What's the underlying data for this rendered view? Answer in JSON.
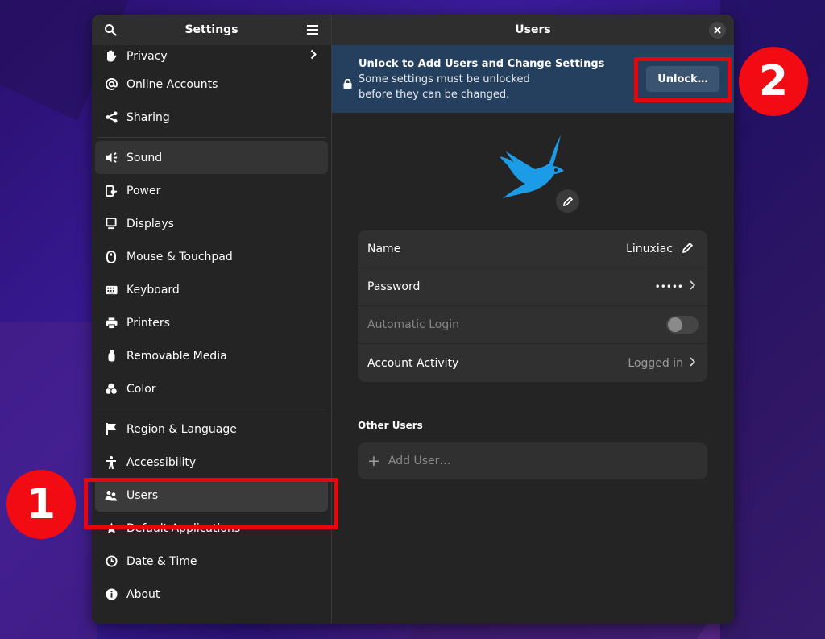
{
  "sidebar": {
    "title": "Settings",
    "items": [
      {
        "label": "Privacy",
        "icon": "hand-icon",
        "has_chevron": true
      },
      {
        "label": "Online Accounts",
        "icon": "at-icon"
      },
      {
        "label": "Sharing",
        "icon": "share-icon"
      },
      {
        "label": "Sound",
        "icon": "speaker-icon"
      },
      {
        "label": "Power",
        "icon": "power-plug-icon"
      },
      {
        "label": "Displays",
        "icon": "display-icon"
      },
      {
        "label": "Mouse & Touchpad",
        "icon": "mouse-icon"
      },
      {
        "label": "Keyboard",
        "icon": "keyboard-icon"
      },
      {
        "label": "Printers",
        "icon": "printer-icon"
      },
      {
        "label": "Removable Media",
        "icon": "usb-drive-icon"
      },
      {
        "label": "Color",
        "icon": "color-icon"
      },
      {
        "label": "Region & Language",
        "icon": "flag-icon"
      },
      {
        "label": "Accessibility",
        "icon": "accessibility-icon"
      },
      {
        "label": "Users",
        "icon": "users-icon",
        "active": true
      },
      {
        "label": "Default Applications",
        "icon": "star-icon"
      },
      {
        "label": "Date & Time",
        "icon": "clock-icon"
      },
      {
        "label": "About",
        "icon": "info-icon"
      }
    ]
  },
  "main": {
    "title": "Users",
    "banner": {
      "title": "Unlock to Add Users and Change Settings",
      "line1": "Some settings must be unlocked",
      "line2": "before they can be changed.",
      "button": "Unlock…"
    },
    "account": {
      "rows": [
        {
          "label": "Name",
          "value": "Linuxiac"
        },
        {
          "label": "Password",
          "value": "•••••"
        },
        {
          "label": "Automatic Login",
          "value": "off"
        },
        {
          "label": "Account Activity",
          "value": "Logged in"
        }
      ]
    },
    "other_users": {
      "heading": "Other Users",
      "add_label": "Add User…"
    }
  },
  "annotations": {
    "step1": "1",
    "step2": "2"
  },
  "colors": {
    "accent_banner": "#25405f",
    "highlight": "#e8060d",
    "avatar_blue": "#1c9be6"
  }
}
